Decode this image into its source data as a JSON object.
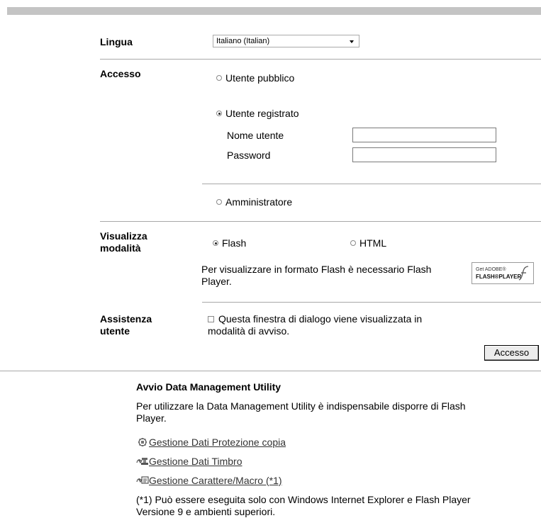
{
  "language": {
    "label": "Lingua",
    "selected": "Italiano (Italian)"
  },
  "access": {
    "label": "Accesso",
    "public_user": "Utente pubblico",
    "registered_user": "Utente registrato",
    "username_label": "Nome utente",
    "password_label": "Password",
    "username_value": "",
    "password_value": "",
    "admin": "Amministratore"
  },
  "view_mode": {
    "label_line1": "Visualizza",
    "label_line2": "modalità",
    "flash": "Flash",
    "html": "HTML",
    "note_line1": "Per visualizzare in formato Flash è necessario Flash",
    "note_line2": "Player.",
    "badge_line1": "Get ADOBE®",
    "badge_line2": "FLASH®PLAYER"
  },
  "user_assist": {
    "label_line1": "Assistenza",
    "label_line2": "utente",
    "checkbox_line1": "Questa finestra di dialogo viene visualizzata in",
    "checkbox_line2": "modalità di avviso."
  },
  "submit_label": "Accesso",
  "dmu": {
    "title": "Avvio Data Management Utility",
    "desc_line1": "Per utilizzare la Data Management Utility è indispensabile disporre di Flash",
    "desc_line2": "Player.",
    "links": [
      {
        "label": "Gestione Dati Protezione copia",
        "icon": "copy-protection-icon"
      },
      {
        "label": "Gestione Dati Timbro",
        "icon": "stamp-icon"
      },
      {
        "label": "Gestione Carattere/Macro (*1)",
        "icon": "font-macro-icon"
      }
    ],
    "footnote_line1": "(*1) Può essere eseguita solo con Windows Internet Explorer e Flash Player",
    "footnote_line2": "Versione 9 e ambienti superiori."
  }
}
